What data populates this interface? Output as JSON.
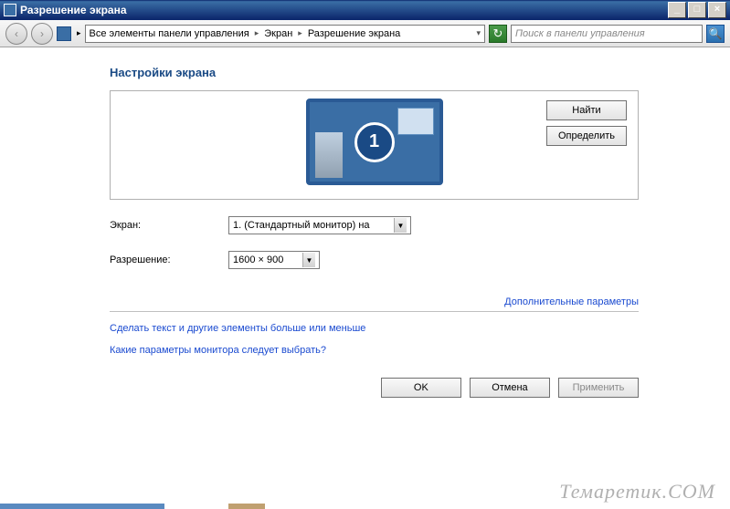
{
  "titlebar": {
    "title": "Разрешение экрана",
    "min": "_",
    "max": "□",
    "close": "×"
  },
  "toolbar": {
    "back": "‹",
    "forward": "›",
    "crumbs": [
      "Все элементы панели управления",
      "Экран",
      "Разрешение экрана"
    ],
    "sep": "▸",
    "drop": "▾",
    "refresh": "↻",
    "search_placeholder": "Поиск в панели управления",
    "search_icon": "🔍"
  },
  "main": {
    "heading": "Настройки экрана",
    "monitor_number": "1",
    "find_btn": "Найти",
    "identify_btn": "Определить",
    "display_label": "Экран:",
    "display_value": "1. (Стандартный монитор) на",
    "resolution_label": "Разрешение:",
    "resolution_value": "1600 × 900",
    "dd_arrow": "▼",
    "adv_link": "Дополнительные параметры",
    "link1": "Сделать текст и другие элементы больше или меньше",
    "link2": "Какие параметры монитора следует выбрать?",
    "ok": "OK",
    "cancel": "Отмена",
    "apply": "Применить"
  },
  "watermark": "Темаретик.COM"
}
